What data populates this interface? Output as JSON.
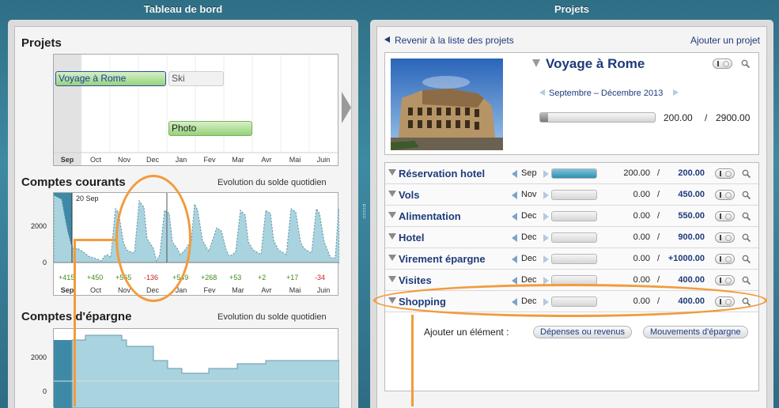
{
  "left_pane": {
    "title": "Tableau de bord",
    "projects": {
      "title": "Projets",
      "bars": [
        {
          "label": "Voyage à Rome"
        },
        {
          "label": "Ski"
        },
        {
          "label": "Photo"
        }
      ],
      "months": [
        "Sep",
        "Oct",
        "Nov",
        "Dec",
        "Jan",
        "Fev",
        "Mar",
        "Avr",
        "Mai",
        "Juin"
      ]
    },
    "current_accounts": {
      "title": "Comptes courants",
      "subtitle": "Evolution du solde quotidien",
      "date_marker": "20 Sep",
      "y_labels": [
        "2000",
        "0"
      ],
      "deltas": [
        {
          "text": "+415",
          "sign": "pos"
        },
        {
          "text": "+450",
          "sign": "pos"
        },
        {
          "text": "+565",
          "sign": "pos"
        },
        {
          "text": "-136",
          "sign": "neg"
        },
        {
          "text": "+549",
          "sign": "pos"
        },
        {
          "text": "+268",
          "sign": "pos"
        },
        {
          "text": "+53",
          "sign": "pos"
        },
        {
          "text": "+2",
          "sign": "pos"
        },
        {
          "text": "+17",
          "sign": "pos"
        },
        {
          "text": "-34",
          "sign": "neg"
        }
      ],
      "months": [
        "Sep",
        "Oct",
        "Nov",
        "Dec",
        "Jan",
        "Fev",
        "Mar",
        "Avr",
        "Mai",
        "Juin"
      ]
    },
    "savings_accounts": {
      "title": "Comptes d'épargne",
      "subtitle": "Evolution du solde quotidien",
      "y_labels": [
        "2000",
        "0"
      ]
    }
  },
  "right_pane": {
    "title": "Projets",
    "back_link": "Revenir à la liste des projets",
    "add_project": "Ajouter un projet",
    "project": {
      "name": "Voyage à Rome",
      "period": "Septembre – Décembre 2013",
      "spent": "200.00",
      "slash": "/",
      "total": "2900.00",
      "progress": 0.07
    },
    "items": [
      {
        "name": "Réservation hotel",
        "month": "Sep",
        "spent": "200.00",
        "budget": "200.00",
        "progress": 1.0
      },
      {
        "name": "Vols",
        "month": "Nov",
        "spent": "0.00",
        "budget": "450.00",
        "progress": 0
      },
      {
        "name": "Alimentation",
        "month": "Dec",
        "spent": "0.00",
        "budget": "550.00",
        "progress": 0
      },
      {
        "name": "Hotel",
        "month": "Dec",
        "spent": "0.00",
        "budget": "900.00",
        "progress": 0
      },
      {
        "name": "Virement épargne",
        "month": "Dec",
        "spent": "0.00",
        "budget": "+1000.00",
        "progress": 0
      },
      {
        "name": "Visites",
        "month": "Dec",
        "spent": "0.00",
        "budget": "400.00",
        "progress": 0
      },
      {
        "name": "Shopping",
        "month": "Dec",
        "spent": "0.00",
        "budget": "400.00",
        "progress": 0
      }
    ],
    "add_element_label": "Ajouter un élément :",
    "add_expense_button": "Dépenses ou revenus",
    "add_savings_button": "Mouvements d'épargne"
  },
  "colors": {
    "accent_orange": "#f29b3c",
    "chart_fill": "#a9d3de",
    "chart_fill_dark": "#3e8aa6",
    "link_blue": "#1e3b7a"
  }
}
